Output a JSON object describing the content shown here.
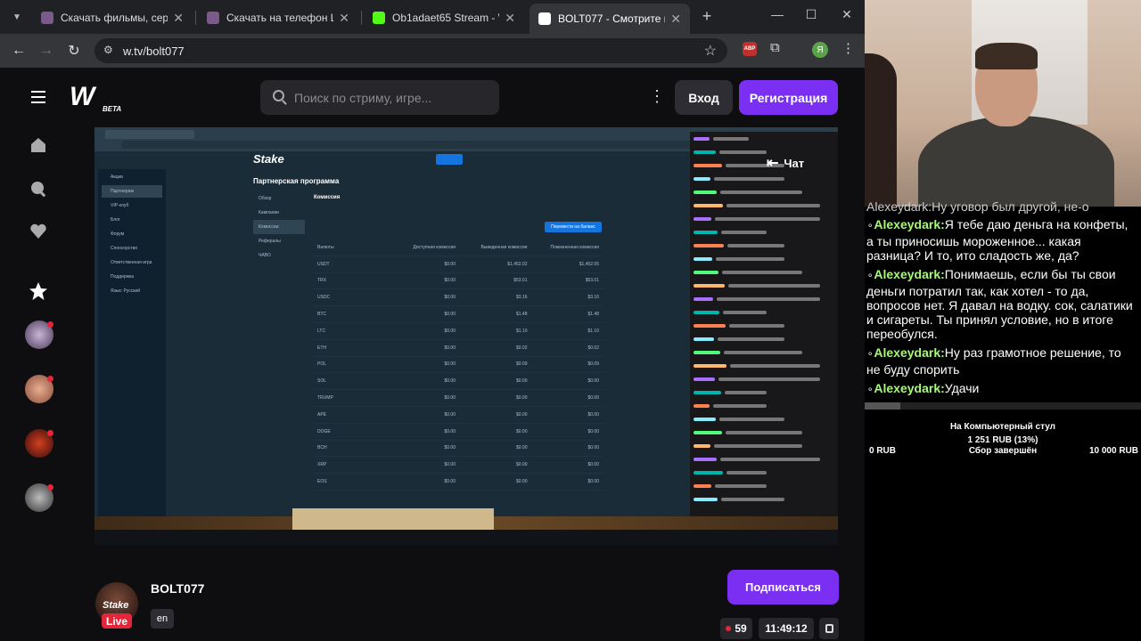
{
  "browser": {
    "tabs": [
      {
        "title": "Скачать фильмы, сериалы",
        "favicon_color": "#7a5a8a"
      },
      {
        "title": "Скачать на телефон Цикл",
        "favicon_color": "#7a5a8a"
      },
      {
        "title": "Ob1adaet65 Stream - Watc",
        "favicon_color": "#53fc18"
      },
      {
        "title": "BOLT077 - Смотрите в Ла",
        "favicon_color": "#ffffff"
      }
    ],
    "active_tab": 3,
    "url": "w.tv/bolt077",
    "ext_abp": "ABP",
    "profile_letter": "Я"
  },
  "site": {
    "logo": "W",
    "logo_beta": "BETA",
    "search_placeholder": "Поиск по стриму, игре...",
    "login_label": "Вход",
    "register_label": "Регистрация",
    "rail_icons": [
      "home-icon",
      "search-icon",
      "heart-icon",
      "star-icon"
    ]
  },
  "video": {
    "stake_logo": "Stake",
    "page_title": "Партнерская программа",
    "sidebar_items": [
      "Акции",
      "Партнерам",
      "VIP-клуб",
      "Блог",
      "Форум",
      "Спонсорство",
      "Ответственная игра",
      "Поддержка",
      "Язык: Русский"
    ],
    "submenu_items": [
      "Обзор",
      "Кампании",
      "Комиссии",
      "Рефералы",
      "ЧАВО"
    ],
    "section_title": "Комиссия",
    "withdraw_button": "Перевести на баланс",
    "table_headers": [
      "Валюты",
      "Доступная комиссия",
      "Выведенная комиссия",
      "Пожизненная комиссия"
    ],
    "table_rows": [
      [
        "USDT",
        "$0.00",
        "$1,452.02",
        "$1,452.05"
      ],
      [
        "TRX",
        "$0.00",
        "$53.01",
        "$53.01"
      ],
      [
        "USDC",
        "$0.00",
        "$3.16",
        "$3.16"
      ],
      [
        "BTC",
        "$0.00",
        "$1.48",
        "$1.48"
      ],
      [
        "LTC",
        "$0.00",
        "$1.10",
        "$1.10"
      ],
      [
        "ETH",
        "$0.00",
        "$0.02",
        "$0.02"
      ],
      [
        "POL",
        "$0.00",
        "$0.09",
        "$0.09"
      ],
      [
        "SOL",
        "$0.00",
        "$0.00",
        "$0.00"
      ],
      [
        "TRUMP",
        "$0.00",
        "$0.00",
        "$0.00"
      ],
      [
        "APE",
        "$0.00",
        "$0.00",
        "$0.00"
      ],
      [
        "DOGE",
        "$0.00",
        "$0.00",
        "$0.00"
      ],
      [
        "BCH",
        "$0.00",
        "$0.00",
        "$0.00"
      ],
      [
        "XRP",
        "$0.00",
        "$0.00",
        "$0.00"
      ],
      [
        "EOS",
        "$0.00",
        "$0.00",
        "$0.00"
      ]
    ],
    "chat_overlay_label": "Чат"
  },
  "channel": {
    "name": "BOLT077",
    "avatar_text": "Stake",
    "live_label": "Live",
    "language": "en",
    "subscribe_label": "Подписаться",
    "viewers": "59",
    "uptime": "11:49:12"
  },
  "right_chat": {
    "cut_line": "Alexeydark:Ну уговор был другой, не-о",
    "messages": [
      {
        "nick": "Alexeydark:",
        "text": "Я тебе даю деньга на конфеты, а ты приносишь мороженное... какая разница? И то, ито сладость же, да?"
      },
      {
        "nick": "Alexeydark:",
        "text": "Понимаешь, если бы ты свои деньги потратил так, как хотел - то да, вопросов нет. Я давал на водку. сок, салатики и сигареты. Ты принял условие, но в итоге переобулся."
      },
      {
        "nick": "Alexeydark:",
        "text": "Ну раз грамотное решение, то не буду спорить"
      },
      {
        "nick": "Alexeydark:",
        "text": "Удачи"
      }
    ]
  },
  "donation": {
    "title": "На Компьютерный стул",
    "amount": "1 251 RUB (13%)",
    "progress_fraction": 0.13,
    "min": "0 RUB",
    "status": "Сбор завершён",
    "max": "10 000 RUB"
  },
  "colors": {
    "accent": "#7b2ff2",
    "live": "#e5263a",
    "chat_nick": "#a6f87a"
  }
}
